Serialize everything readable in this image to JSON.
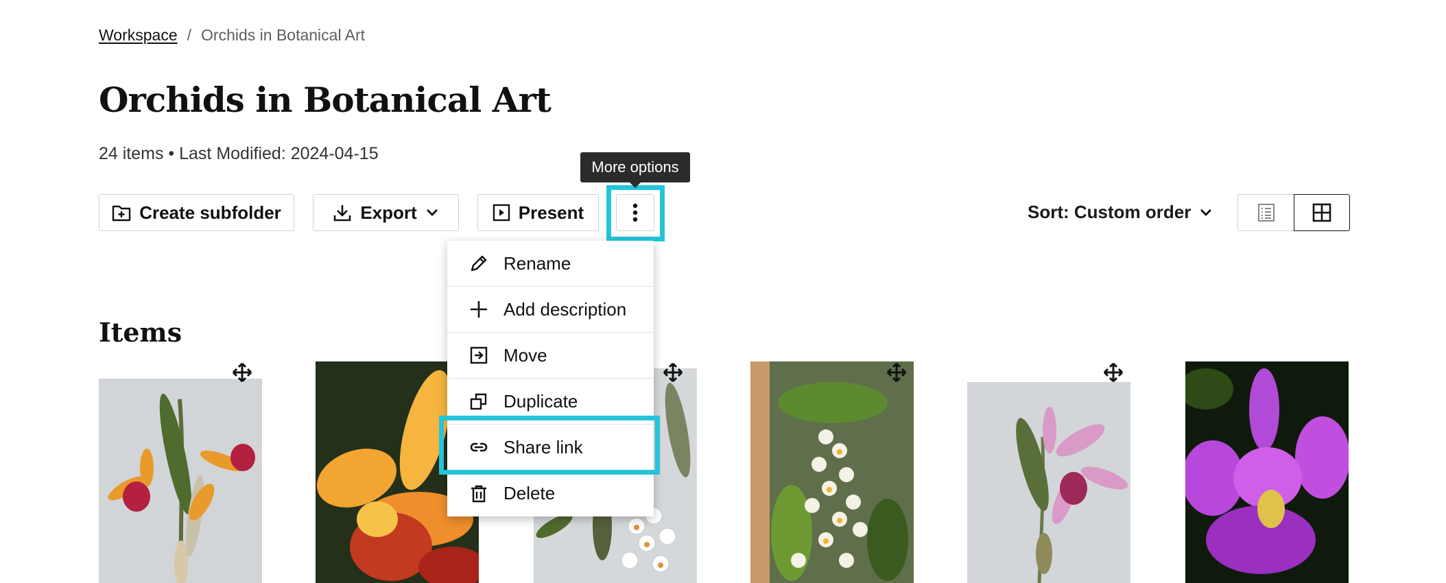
{
  "breadcrumb": {
    "root": "Workspace",
    "separator": "/",
    "current": "Orchids in Botanical Art"
  },
  "page": {
    "title": "Orchids in Botanical Art",
    "meta": "24 items • Last Modified: 2024-04-15"
  },
  "toolbar": {
    "create_subfolder": "Create subfolder",
    "export": "Export",
    "present": "Present",
    "more_tooltip": "More options",
    "sort_label": "Sort: Custom order"
  },
  "section": {
    "items_heading": "Items"
  },
  "menu": {
    "items": [
      {
        "label": "Rename",
        "icon": "pencil-icon"
      },
      {
        "label": "Add description",
        "icon": "plus-icon"
      },
      {
        "label": "Move",
        "icon": "move-into-icon"
      },
      {
        "label": "Duplicate",
        "icon": "duplicate-icon"
      },
      {
        "label": "Share link",
        "icon": "link-icon"
      },
      {
        "label": "Delete",
        "icon": "trash-icon"
      }
    ]
  },
  "thumbnails": [
    {
      "name": "orchid-illustration-orange"
    },
    {
      "name": "orchid-photo-orange"
    },
    {
      "name": "orchid-illustration-white"
    },
    {
      "name": "orchid-photo-white-cluster"
    },
    {
      "name": "orchid-illustration-pink"
    },
    {
      "name": "orchid-photo-purple"
    }
  ],
  "colors": {
    "highlight": "#26c4da",
    "tooltip_bg": "#2b2b2b",
    "border": "#cfcfcf"
  }
}
